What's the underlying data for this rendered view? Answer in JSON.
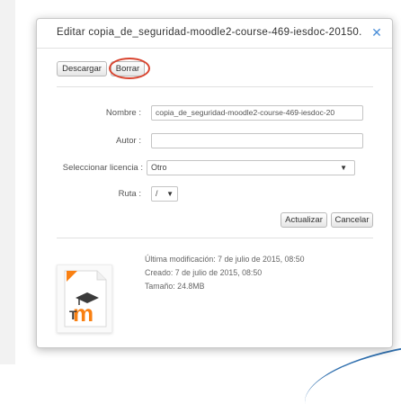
{
  "dialog": {
    "title": "Editar copia_de_seguridad-moodle2-course-469-iesdoc-20150...",
    "close_glyph": "✕"
  },
  "toolbar": {
    "download_label": "Descargar",
    "delete_label": "Borrar"
  },
  "form": {
    "name_label": "Nombre :",
    "name_value": "copia_de_seguridad-moodle2-course-469-iesdoc-20",
    "author_label": "Autor :",
    "author_value": "",
    "license_label": "Seleccionar licencia :",
    "license_value": "Otro",
    "path_label": "Ruta :",
    "path_value": "/",
    "update_label": "Actualizar",
    "cancel_label": "Cancelar"
  },
  "file_info": {
    "modified": "Última modificación: 7 de julio de 2015, 08:50",
    "created": "Creado: 7 de julio de 2015, 08:50",
    "size": "Tamaño: 24.8MB",
    "icon": "moodle-backup-file-icon"
  },
  "colors": {
    "accent": "#4a8ed8",
    "highlight": "#d9442f",
    "moodle_orange": "#f98012"
  }
}
